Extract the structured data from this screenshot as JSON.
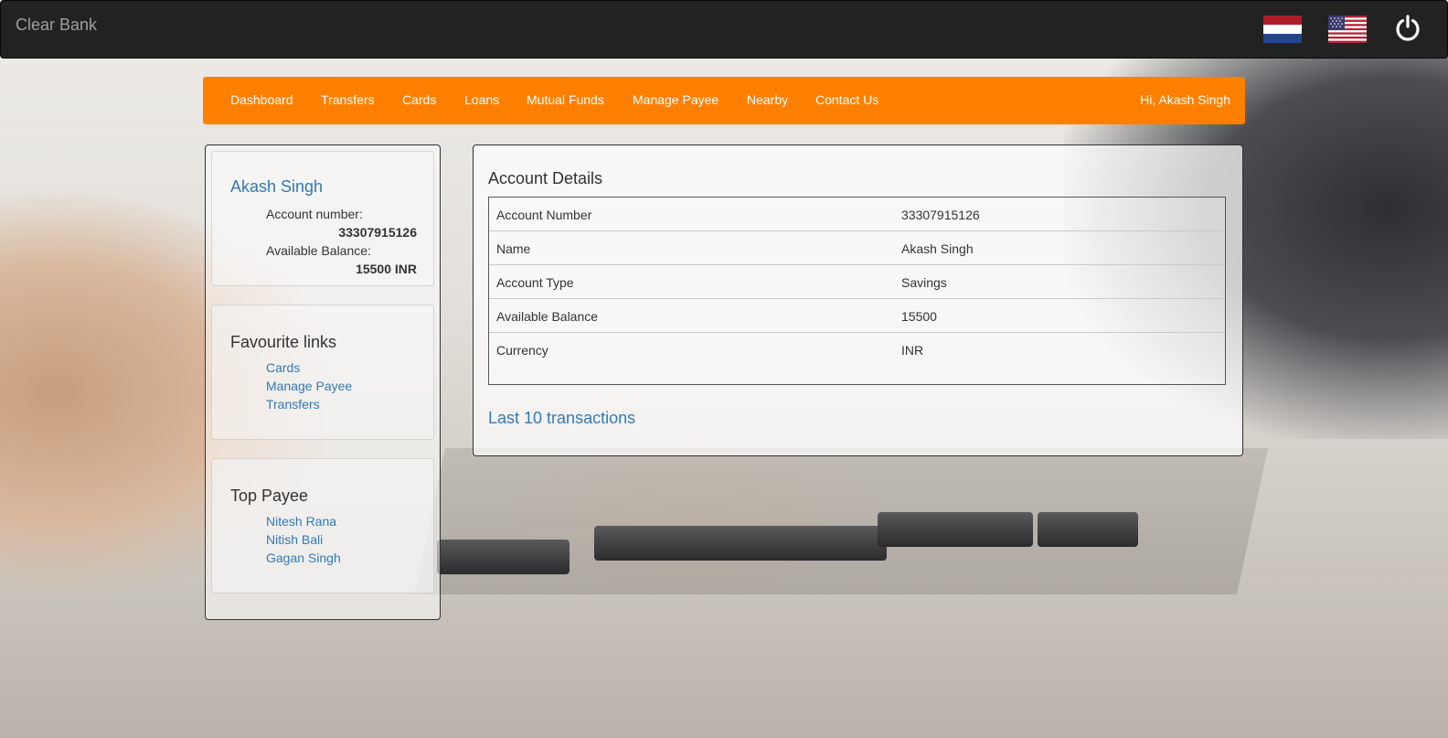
{
  "app": {
    "brand": "Clear Bank"
  },
  "header": {
    "flags": [
      "netherlands-flag-icon",
      "usa-flag-icon"
    ],
    "power_icon": "power-icon"
  },
  "menu": {
    "items": [
      "Dashboard",
      "Transfers",
      "Cards",
      "Loans",
      "Mutual Funds",
      "Manage Payee",
      "Nearby",
      "Contact Us"
    ],
    "greeting": "Hi, Akash Singh",
    "color": "#ff8000"
  },
  "profile": {
    "name": "Akash Singh",
    "account_number_label": "Account number:",
    "account_number": "33307915126",
    "balance_label": "Available Balance:",
    "balance": "15500 INR"
  },
  "favourite_links": {
    "title": "Favourite links",
    "links": [
      "Cards",
      "Manage Payee",
      "Transfers"
    ]
  },
  "top_payee": {
    "title": "Top Payee",
    "payees": [
      "Nitesh Rana",
      "Nitish Bali",
      "Gagan Singh"
    ]
  },
  "account_details": {
    "title": "Account Details",
    "rows": [
      {
        "label": "Account Number",
        "value": "33307915126"
      },
      {
        "label": "Name",
        "value": "Akash Singh"
      },
      {
        "label": "Account Type",
        "value": "Savings"
      },
      {
        "label": "Available Balance",
        "value": "15500"
      },
      {
        "label": "Currency",
        "value": "INR"
      }
    ]
  },
  "transactions": {
    "link_label": "Last 10 transactions"
  },
  "colors": {
    "link": "#337ab7",
    "navbar": "#222222"
  }
}
